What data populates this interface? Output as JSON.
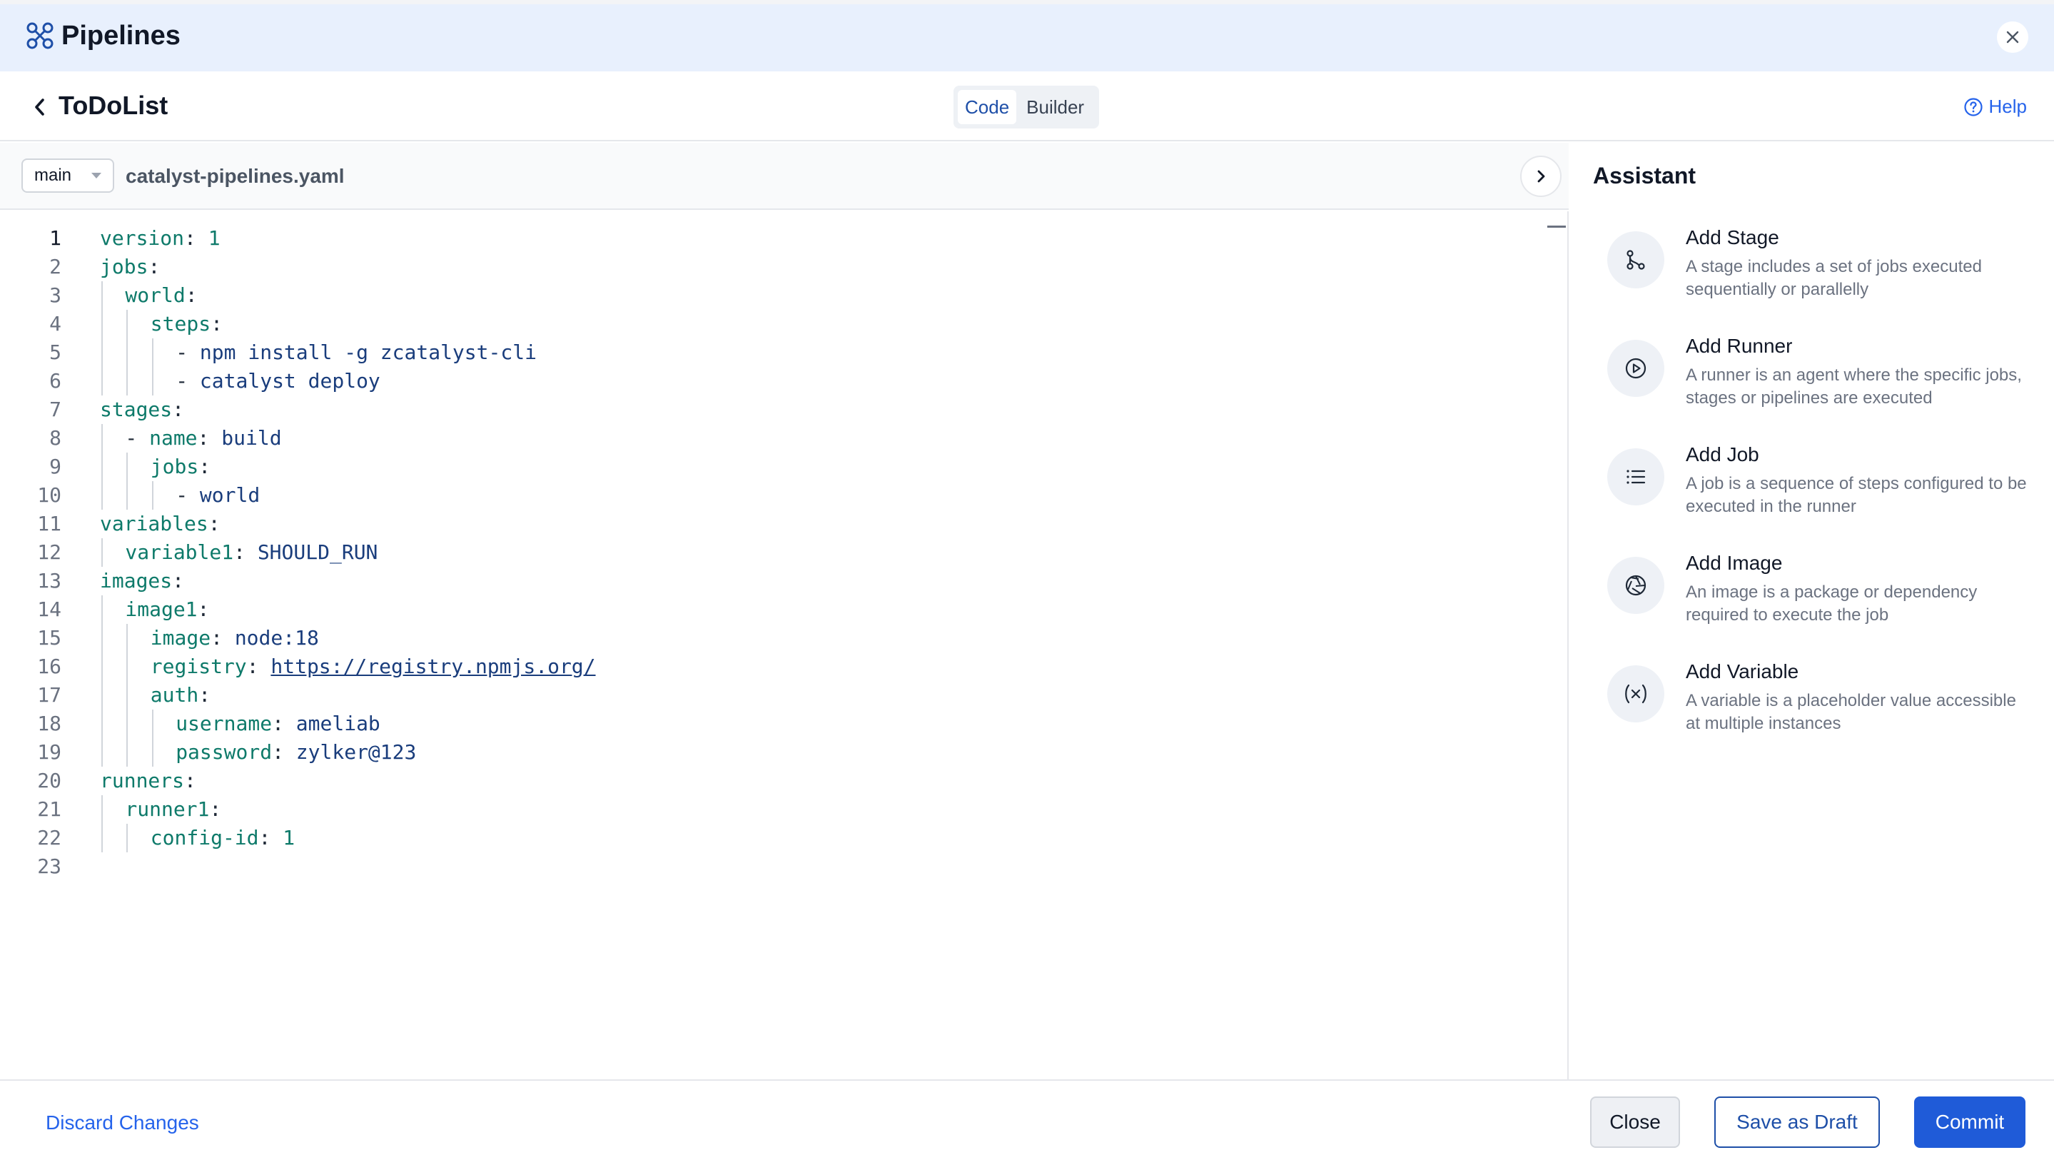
{
  "app": {
    "title": "Pipelines"
  },
  "project": {
    "title": "ToDoList"
  },
  "view_toggle": {
    "code": "Code",
    "builder": "Builder",
    "active": "code"
  },
  "help": {
    "label": "Help"
  },
  "toolbar": {
    "branch": "main",
    "filename": "catalyst-pipelines.yaml"
  },
  "editor": {
    "current_line": 1,
    "line_numbers": [
      "1",
      "2",
      "3",
      "4",
      "5",
      "6",
      "7",
      "8",
      "9",
      "10",
      "11",
      "12",
      "13",
      "14",
      "15",
      "16",
      "17",
      "18",
      "19",
      "20",
      "21",
      "22",
      "23"
    ],
    "lines": [
      {
        "indent": 0,
        "key": "version",
        "sep": ": ",
        "value": "1",
        "vtype": "number"
      },
      {
        "indent": 0,
        "key": "jobs",
        "sep": ":",
        "value": "",
        "vtype": ""
      },
      {
        "indent": 1,
        "key": "world",
        "sep": ":",
        "value": "",
        "vtype": ""
      },
      {
        "indent": 2,
        "key": "steps",
        "sep": ":",
        "value": "",
        "vtype": ""
      },
      {
        "indent": 3,
        "key": "",
        "sep": "- ",
        "value": "npm install -g zcatalyst-cli",
        "vtype": "string"
      },
      {
        "indent": 3,
        "key": "",
        "sep": "- ",
        "value": "catalyst deploy",
        "vtype": "string"
      },
      {
        "indent": 0,
        "key": "stages",
        "sep": ":",
        "value": "",
        "vtype": ""
      },
      {
        "indent": 1,
        "key": "- name",
        "sep": ": ",
        "value": "build",
        "vtype": "string"
      },
      {
        "indent": 2,
        "key": "jobs",
        "sep": ":",
        "value": "",
        "vtype": ""
      },
      {
        "indent": 3,
        "key": "",
        "sep": "- ",
        "value": "world",
        "vtype": "string"
      },
      {
        "indent": 0,
        "key": "variables",
        "sep": ":",
        "value": "",
        "vtype": ""
      },
      {
        "indent": 1,
        "key": "variable1",
        "sep": ": ",
        "value": "SHOULD_RUN",
        "vtype": "string"
      },
      {
        "indent": 0,
        "key": "images",
        "sep": ":",
        "value": "",
        "vtype": ""
      },
      {
        "indent": 1,
        "key": "image1",
        "sep": ":",
        "value": "",
        "vtype": ""
      },
      {
        "indent": 2,
        "key": "image",
        "sep": ": ",
        "value": "node:18",
        "vtype": "string"
      },
      {
        "indent": 2,
        "key": "registry",
        "sep": ": ",
        "value": "https://registry.npmjs.org/",
        "vtype": "url"
      },
      {
        "indent": 2,
        "key": "auth",
        "sep": ":",
        "value": "",
        "vtype": ""
      },
      {
        "indent": 3,
        "key": "username",
        "sep": ": ",
        "value": "ameliab",
        "vtype": "string"
      },
      {
        "indent": 3,
        "key": "password",
        "sep": ": ",
        "value": "zylker@123",
        "vtype": "string"
      },
      {
        "indent": 0,
        "key": "runners",
        "sep": ":",
        "value": "",
        "vtype": ""
      },
      {
        "indent": 1,
        "key": "runner1",
        "sep": ":",
        "value": "",
        "vtype": ""
      },
      {
        "indent": 2,
        "key": "config-id",
        "sep": ": ",
        "value": "1",
        "vtype": "number"
      },
      {
        "indent": 0,
        "key": "",
        "sep": "",
        "value": "",
        "vtype": ""
      }
    ]
  },
  "assistant": {
    "title": "Assistant",
    "items": [
      {
        "title": "Add Stage",
        "desc": "A stage includes a set of jobs executed sequentially or parallelly",
        "icon": "stage-icon"
      },
      {
        "title": "Add Runner",
        "desc": "A runner is an agent where the specific jobs, stages or pipelines are executed",
        "icon": "play-circle-icon"
      },
      {
        "title": "Add Job",
        "desc": "A job is a sequence of steps configured to be executed in the runner",
        "icon": "list-icon"
      },
      {
        "title": "Add Image",
        "desc": "An image is a package or dependency required to execute the job",
        "icon": "aperture-icon"
      },
      {
        "title": "Add Variable",
        "desc": "A variable is a placeholder value accessible at multiple instances",
        "icon": "variable-icon"
      }
    ]
  },
  "footer": {
    "discard": "Discard Changes",
    "close": "Close",
    "save_draft": "Save as Draft",
    "commit": "Commit"
  },
  "colors": {
    "accent": "#1f5bd8",
    "topbar": "#e8f0fd",
    "code_key": "#0e7a6a",
    "code_value": "#1a3d7c"
  }
}
